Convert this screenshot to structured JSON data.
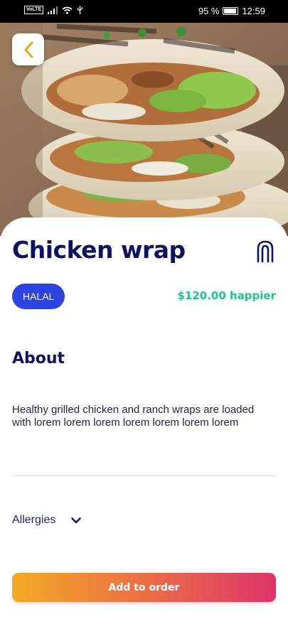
{
  "status_bar": {
    "network_badge": "VoLTE",
    "battery_percent": "95 %",
    "time": "12:59"
  },
  "icons": {
    "back": "chevron-left-icon",
    "favorite": "bookmark-icon",
    "dropdown": "chevron-down-icon"
  },
  "product": {
    "name": "Chicken wrap",
    "badge": "HALAL",
    "price": "$120.00 happier",
    "about_heading": "About",
    "description": "Healthy grilled chicken and ranch wraps are loaded with lorem lorem lorem lorem lorem lorem lorem"
  },
  "allergies": {
    "label": "Allergies"
  },
  "actions": {
    "add_to_order": "Add to order"
  },
  "colors": {
    "title": "#0d1360",
    "badge": "#2d44e0",
    "price": "#22c38a",
    "back_chevron": "#f0a21c",
    "gradient_start": "#f2aa25",
    "gradient_end": "#dc356a"
  }
}
